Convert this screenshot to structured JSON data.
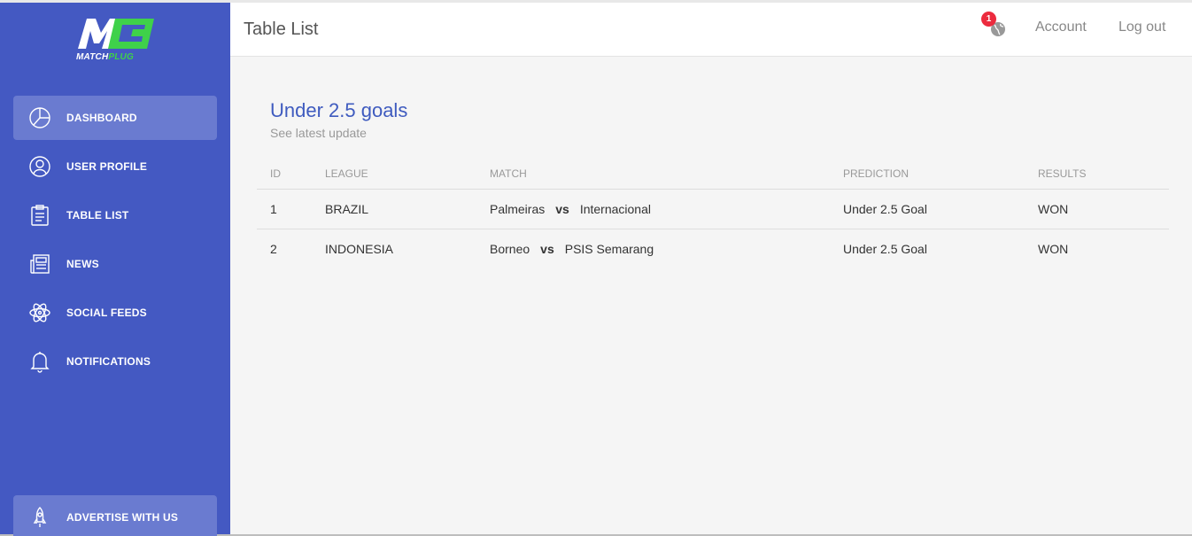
{
  "app": {
    "logo_text_main": "MATCH",
    "logo_text_accent": "PLUG",
    "brand_color": "#4459c2",
    "accent_color": "#3fd14a"
  },
  "sidebar": {
    "items": [
      {
        "label": "DASHBOARD",
        "icon": "pie-chart-icon",
        "active": true
      },
      {
        "label": "USER PROFILE",
        "icon": "user-icon"
      },
      {
        "label": "TABLE LIST",
        "icon": "clipboard-icon"
      },
      {
        "label": "NEWS",
        "icon": "newspaper-icon"
      },
      {
        "label": "SOCIAL FEEDS",
        "icon": "atom-icon"
      },
      {
        "label": "NOTIFICATIONS",
        "icon": "bell-icon"
      }
    ],
    "advertise": {
      "label": "ADVERTISE WITH US",
      "icon": "rocket-icon"
    }
  },
  "topbar": {
    "title": "Table List",
    "notification_count": "1",
    "account_label": "Account",
    "logout_label": "Log out"
  },
  "card": {
    "title": "Under 2.5 goals",
    "subtitle": "See latest update"
  },
  "table": {
    "headers": [
      "ID",
      "LEAGUE",
      "MATCH",
      "PREDICTION",
      "RESULTS"
    ],
    "vs_label": "vs",
    "rows": [
      {
        "id": "1",
        "league": "BRAZIL",
        "home": "Palmeiras",
        "away": "Internacional",
        "prediction": "Under 2.5 Goal",
        "result": "WON"
      },
      {
        "id": "2",
        "league": "INDONESIA",
        "home": "Borneo",
        "away": "PSIS Semarang",
        "prediction": "Under 2.5 Goal",
        "result": "WON"
      }
    ]
  }
}
